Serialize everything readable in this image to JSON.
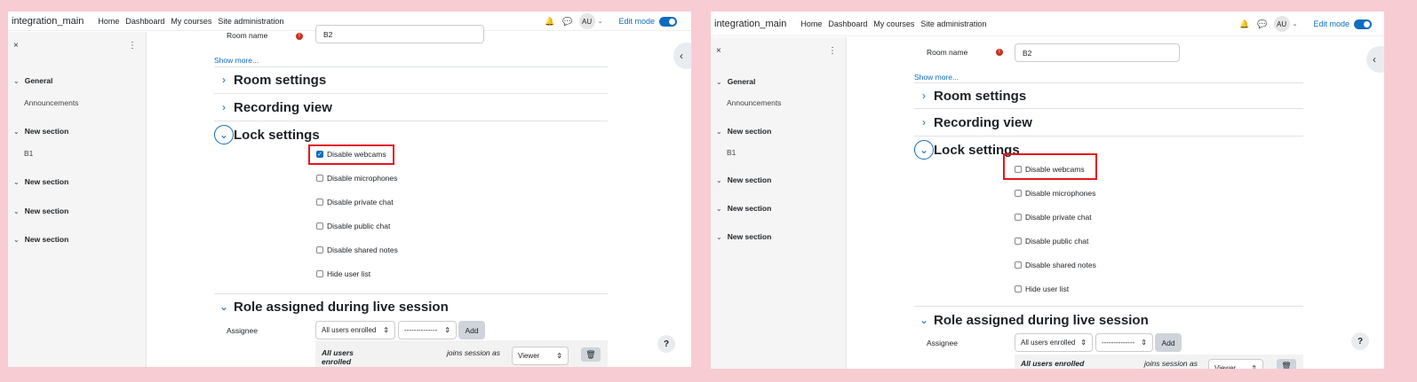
{
  "nav": {
    "brand": "integration_main",
    "links": [
      "Home",
      "Dashboard",
      "My courses",
      "Site administration"
    ],
    "avatar": "AU",
    "edit_mode": "Edit mode"
  },
  "drawer": {
    "close": "×",
    "more": "⋮",
    "general": "General",
    "announcements": "Announcements",
    "new_section": "New section",
    "b1": "B1"
  },
  "form": {
    "room_name_label": "Room name",
    "room_name_value": "B2",
    "show_more": "Show more...",
    "room_settings": "Room settings",
    "recording_view": "Recording view",
    "lock_settings": "Lock settings",
    "checkboxes": [
      "Disable webcams",
      "Disable microphones",
      "Disable private chat",
      "Disable public chat",
      "Disable shared notes",
      "Hide user list"
    ],
    "role_assigned": "Role assigned during live session",
    "assignee_label": "Assignee",
    "assignee_select": "All users enrolled",
    "second_select": "--------------",
    "add_button": "Add",
    "row_name": "All users enrolled",
    "row_joins": "joins session as",
    "row_role": "Viewer"
  },
  "left_state": {
    "webcams_checked": true
  },
  "right_state": {
    "webcams_checked": false
  },
  "colors": {
    "highlight": "#e3171e",
    "accent": "#0f6cbf",
    "background": "#f8ccd3"
  }
}
